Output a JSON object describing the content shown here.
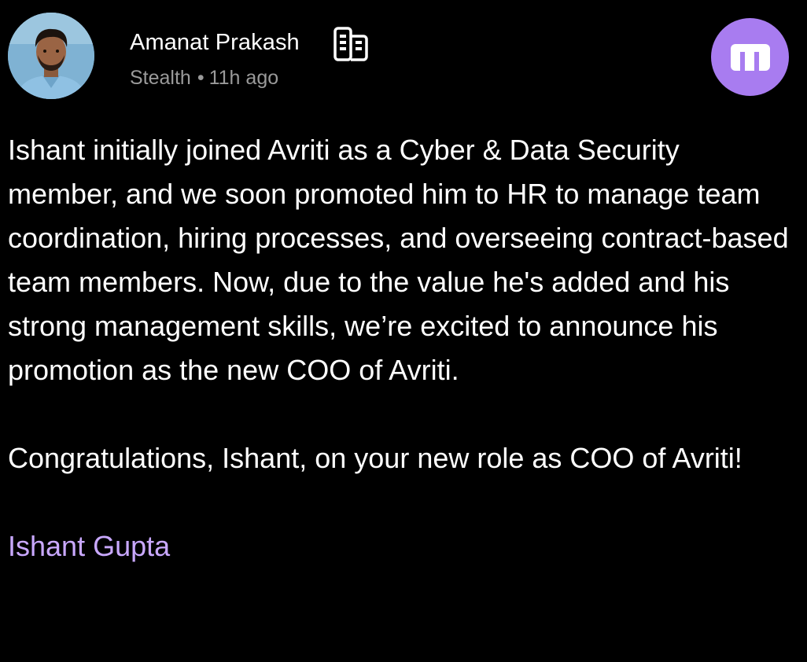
{
  "post": {
    "author": {
      "name": "Amanat Prakash",
      "company": "Stealth",
      "time": "11h ago",
      "separator": "•",
      "company_icon": "building-icon",
      "avatar": "profile-photo"
    },
    "brand_badge": {
      "icon": "m-logo-icon",
      "color": "#a87cf0"
    },
    "body": {
      "paragraph1": "Ishant initially joined Avriti as a Cyber & Data Security member, and we soon promoted him to HR to manage team coordination, hiring processes, and overseeing contract-based team members. Now, due to the value he's added and his strong management skills, we’re excited to announce his promotion as the new COO of Avriti.",
      "paragraph2": "Congratulations, Ishant, on your new role as COO of Avriti!",
      "mention": "Ishant Gupta"
    },
    "colors": {
      "background": "#000000",
      "text": "#ffffff",
      "meta": "#9a9a9a",
      "mention": "#c9a8ff"
    }
  }
}
